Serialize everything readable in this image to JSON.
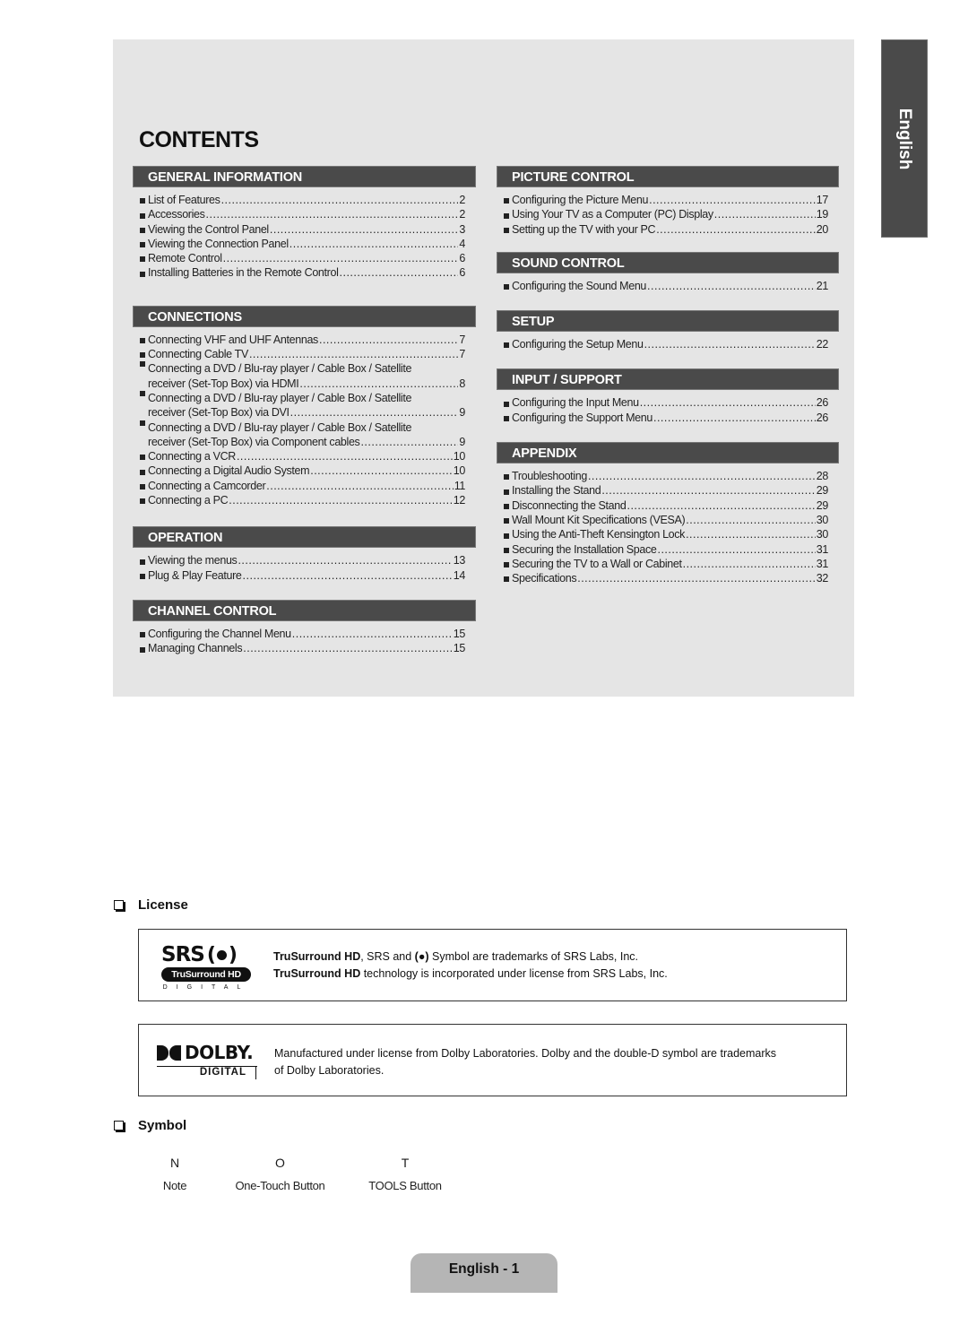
{
  "header": {
    "title": "CONTENTS"
  },
  "language_tab": {
    "label": "English"
  },
  "left_column": [
    {
      "title": "GENERAL INFORMATION",
      "items": [
        {
          "label": "List of Features",
          "page": "2"
        },
        {
          "label": "Accessories",
          "page": "2"
        },
        {
          "label": "Viewing the Control Panel",
          "page": "3"
        },
        {
          "label": "Viewing the Connection Panel",
          "page": "4"
        },
        {
          "label": "Remote Control",
          "page": "6"
        },
        {
          "label": "Installing Batteries in the Remote Control",
          "page": "6"
        }
      ]
    },
    {
      "title": "CONNECTIONS",
      "items": [
        {
          "label": "Connecting VHF and UHF Antennas",
          "page": "7"
        },
        {
          "label": "Connecting Cable TV",
          "page": "7"
        },
        {
          "label": "Connecting a DVD / Blu-ray player / Cable Box / Satellite",
          "label2": "receiver (Set-Top Box) via HDMI",
          "page": "8"
        },
        {
          "label": "Connecting a DVD / Blu-ray player / Cable Box / Satellite",
          "label2": "receiver (Set-Top Box) via DVI",
          "page": "9"
        },
        {
          "label": "Connecting a DVD / Blu-ray player / Cable Box / Satellite",
          "label2": "receiver (Set-Top Box) via Component cables",
          "page": "9"
        },
        {
          "label": "Connecting a VCR",
          "page": "10"
        },
        {
          "label": "Connecting a Digital Audio System",
          "page": "10"
        },
        {
          "label": "Connecting a Camcorder",
          "page": "11"
        },
        {
          "label": "Connecting a PC",
          "page": "12"
        }
      ]
    },
    {
      "title": "OPERATION",
      "items": [
        {
          "label": "Viewing the menus",
          "page": "13"
        },
        {
          "label": "Plug & Play Feature",
          "page": "14"
        }
      ]
    },
    {
      "title": "CHANNEL CONTROL",
      "items": [
        {
          "label": "Configuring the Channel Menu",
          "page": "15"
        },
        {
          "label": "Managing Channels",
          "page": "15"
        }
      ]
    }
  ],
  "right_column": [
    {
      "title": "PICTURE CONTROL",
      "items": [
        {
          "label": "Configuring the Picture Menu",
          "page": "17"
        },
        {
          "label": "Using Your TV as a Computer (PC) Display",
          "page": "19"
        },
        {
          "label": "Setting up the TV with your PC",
          "page": "20"
        }
      ]
    },
    {
      "title": "SOUND CONTROL",
      "items": [
        {
          "label": "Configuring the Sound Menu",
          "page": "21"
        }
      ]
    },
    {
      "title": "SETUP",
      "items": [
        {
          "label": "Configuring the Setup Menu",
          "page": "22"
        }
      ]
    },
    {
      "title": "INPUT / SUPPORT",
      "items": [
        {
          "label": "Configuring the Input Menu",
          "page": "26"
        },
        {
          "label": "Configuring the Support Menu",
          "page": "26"
        }
      ]
    },
    {
      "title": "APPENDIX",
      "items": [
        {
          "label": "Troubleshooting",
          "page": "28"
        },
        {
          "label": "Installing the Stand",
          "page": "29"
        },
        {
          "label": "Disconnecting the Stand",
          "page": "29"
        },
        {
          "label": "Wall Mount Kit Specifications (VESA)",
          "page": "30"
        },
        {
          "label": "Using the Anti-Theft Kensington Lock",
          "page": "30"
        },
        {
          "label": "Securing the Installation Space",
          "page": "31"
        },
        {
          "label": "Securing the TV to a Wall or Cabinet",
          "page": "31"
        },
        {
          "label": "Specifications",
          "page": "32"
        }
      ]
    }
  ],
  "license": {
    "heading": "License",
    "srs": {
      "logo_text": "SRS",
      "logo_pill": "TruSurround HD",
      "logo_sub": "DIGITAL",
      "line1_bold": "TruSurround HD",
      "line1_rest_a": ", SRS and ",
      "line1_rest_b": " Symbol are trademarks of SRS Labs, Inc.",
      "line2_bold": "TruSurround HD",
      "line2_rest": " technology is incorporated under license from SRS Labs, Inc."
    },
    "dolby": {
      "logo_text": "DOLBY.",
      "logo_sub": "DIGITAL",
      "line1": "Manufactured under license from Dolby Laboratories. Dolby and the double-D symbol are trademarks",
      "line2": "of Dolby Laboratories."
    }
  },
  "symbol": {
    "heading": "Symbol",
    "items": [
      {
        "glyph": "N",
        "label": "Note"
      },
      {
        "glyph": "O",
        "label": "One-Touch Button"
      },
      {
        "glyph": "T",
        "label": "TOOLS Button"
      }
    ]
  },
  "footer": {
    "page_label": "English - 1"
  },
  "colors": {
    "panel": "#e5e5e5",
    "section_bar": "#4a4a4a",
    "page_tab": "#b5b5b5"
  }
}
